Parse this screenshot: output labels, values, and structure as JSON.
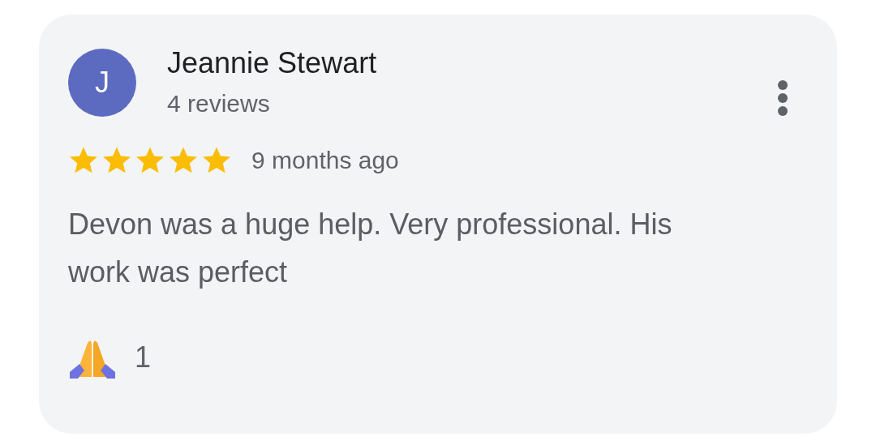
{
  "review": {
    "avatar_letter": "J",
    "name": "Jeannie Stewart",
    "reviews_count": "4 reviews",
    "stars": 5,
    "time": "9 months ago",
    "text": "Devon was a huge help. Very professional. His work was perfect",
    "reactions": [
      {
        "count": "1"
      }
    ]
  }
}
